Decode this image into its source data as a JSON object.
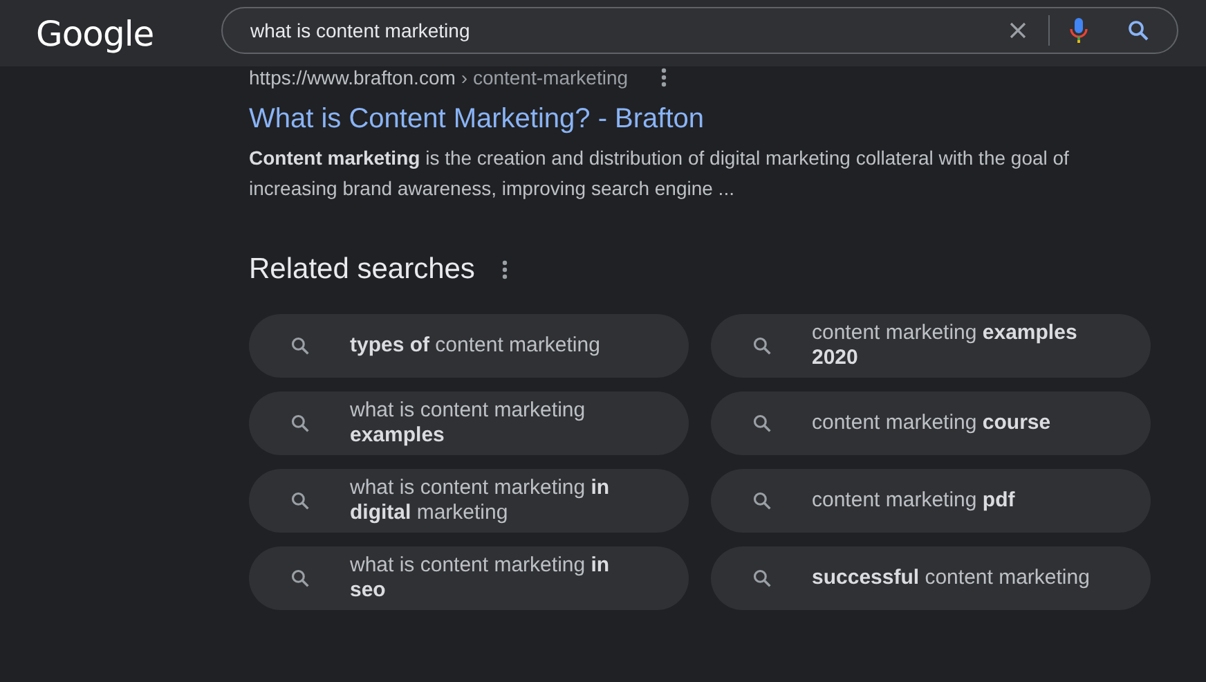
{
  "header": {
    "logo": "Google",
    "search": {
      "value": "what is content marketing"
    }
  },
  "result": {
    "url": "https://www.brafton.com",
    "breadcrumb": "› content-marketing",
    "title": "What is Content Marketing? - Brafton",
    "snippet": "**Content marketing** is the creation and distribution of digital marketing collateral with the goal of increasing brand awareness, improving search engine ..."
  },
  "related": {
    "heading": "Related searches",
    "items": [
      {
        "text": "**types of** content marketing"
      },
      {
        "text": "content marketing **examples 2020**"
      },
      {
        "text": "what is content marketing **examples**"
      },
      {
        "text": "content marketing **course**"
      },
      {
        "text": "what is content marketing **in digital** marketing"
      },
      {
        "text": "content marketing **pdf**"
      },
      {
        "text": "what is content marketing **in seo**"
      },
      {
        "text": "**successful** content marketing"
      }
    ]
  }
}
